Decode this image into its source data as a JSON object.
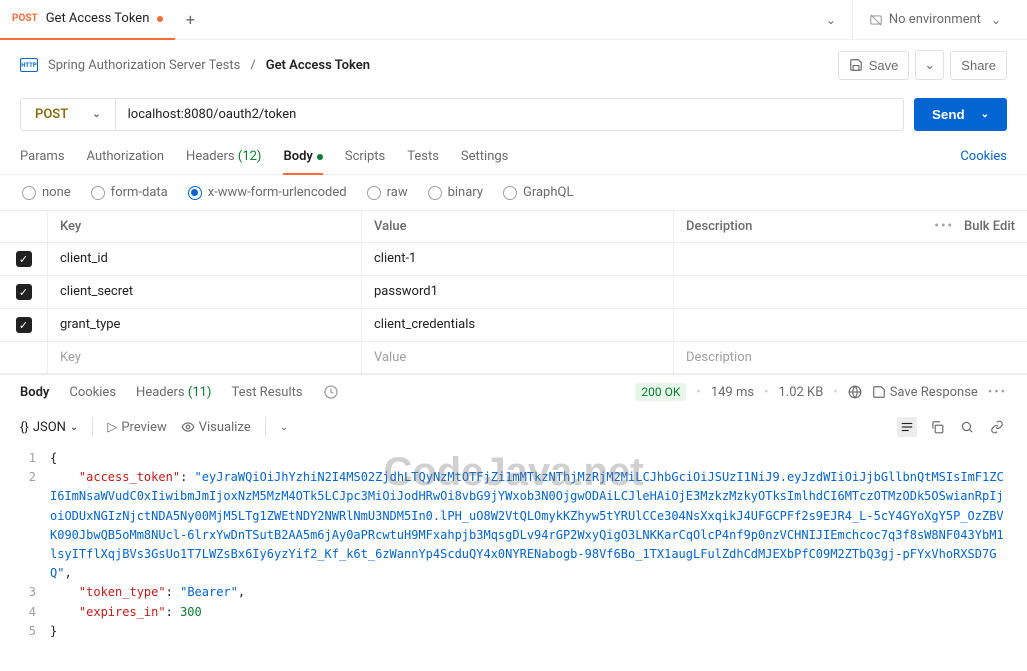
{
  "tab": {
    "method": "POST",
    "title": "Get Access Token"
  },
  "env": {
    "label": "No environment"
  },
  "breadcrumb": {
    "collection": "Spring Authorization Server Tests",
    "request": "Get Access Token"
  },
  "actions": {
    "save": "Save",
    "share": "Share"
  },
  "request": {
    "method": "POST",
    "url": "localhost:8080/oauth2/token",
    "send": "Send"
  },
  "reqTabs": {
    "params": "Params",
    "auth": "Authorization",
    "headers": "Headers",
    "headers_count": "(12)",
    "body": "Body",
    "scripts": "Scripts",
    "tests": "Tests",
    "settings": "Settings",
    "cookies": "Cookies"
  },
  "bodyTypes": {
    "none": "none",
    "formdata": "form-data",
    "urlencoded": "x-www-form-urlencoded",
    "raw": "raw",
    "binary": "binary",
    "graphql": "GraphQL"
  },
  "tableHeaders": {
    "key": "Key",
    "value": "Value",
    "description": "Description",
    "bulk": "Bulk Edit"
  },
  "formRows": [
    {
      "key": "client_id",
      "value": "client-1"
    },
    {
      "key": "client_secret",
      "value": "password1"
    },
    {
      "key": "grant_type",
      "value": "client_credentials"
    }
  ],
  "placeholders": {
    "key": "Key",
    "value": "Value",
    "description": "Description"
  },
  "respTabs": {
    "body": "Body",
    "cookies": "Cookies",
    "headers": "Headers",
    "headers_count": "(11)",
    "test": "Test Results"
  },
  "respMeta": {
    "status": "200 OK",
    "time": "149 ms",
    "size": "1.02 KB",
    "saveResp": "Save Response"
  },
  "respToolbar": {
    "format": "JSON",
    "preview": "Preview",
    "visualize": "Visualize"
  },
  "json": {
    "access_token": "eyJraWQiOiJhYzhiN2I4MS02ZjdhLTQyNzMtOTFjZi1mMTkzNThjMzRjM2MiLCJhbGciOiJSUzI1NiJ9.eyJzdWIiOiJjbGllbnQtMSIsImF1ZCI6ImNsaWVudC0xIiwibmJmIjoxNzM5MzM4OTk5LCJpc3MiOiJodHRwOi8vbG9jYWxob3N0OjgwODAiLCJleHAiOjE3MzkzMzkyOTksImlhdCI6MTczOTMzODk5OSwianRpIjoiODUxNGIzNjctNDA5Ny00MjM5LTg1ZWEtNDY2NWRlNmU3NDM5In0.lPH_uO8W2VtQLOmykKZhyw5tYRUlCCe304NsXxqikJ4UFGCPFf2s9EJR4_L-5cY4GYoXgY5P_OzZBVK090JbwQB5oMm8NUcl-6lrxYwDnTSutB2AA5m6jAy0aPRcwtuH9MFxahpjb3MqsgDLv94rGP2WxyQigO3LNKKarCqOlcP4nf9p0nzVCHNIJIEmchcoc7q3f8sW8NF043YbM1lsyITflXqjBVs3GsUo1T7LWZsBx6Iy6yzYif2_Kf_k6t_6zWannYp4ScduQY4x0NYRENabogb-98Vf6Bo_1TX1augLFulZdhCdMJEXbPfC09M2ZTbQ3gj-pFYxVhoRXSD7GQ",
    "token_type": "Bearer",
    "expires_in": 300
  },
  "watermark": "CodeJava.net"
}
